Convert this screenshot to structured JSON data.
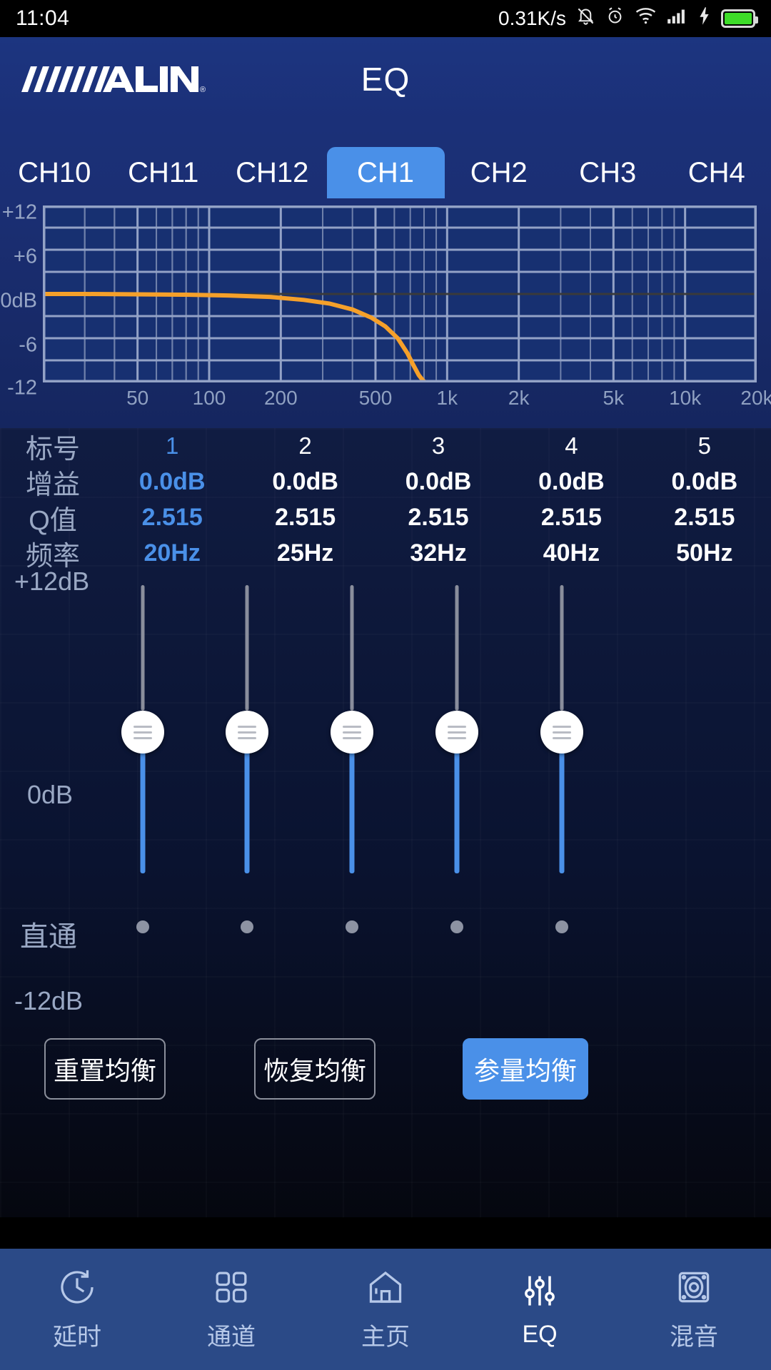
{
  "status_bar": {
    "time": "11:04",
    "network_speed": "0.31K/s",
    "icons": [
      "bell-mute-icon",
      "alarm-icon",
      "wifi-icon",
      "signal-icon",
      "charging-bolt-icon",
      "battery-icon"
    ],
    "battery_color": "#3ddc28"
  },
  "header": {
    "brand": "ALPINE",
    "brand_mark": "®",
    "title": "EQ"
  },
  "channel_tabs": {
    "items": [
      {
        "label": "CH10",
        "active": false
      },
      {
        "label": "CH11",
        "active": false
      },
      {
        "label": "CH12",
        "active": false
      },
      {
        "label": "CH1",
        "active": true
      },
      {
        "label": "CH2",
        "active": false
      },
      {
        "label": "CH3",
        "active": false
      },
      {
        "label": "CH4",
        "active": false
      }
    ],
    "active_color": "#4a90e8"
  },
  "chart_data": {
    "type": "line",
    "title": "",
    "xlabel": "",
    "ylabel": "",
    "x_ticks": [
      "50",
      "100",
      "200",
      "500",
      "1k",
      "2k",
      "5k",
      "10k",
      "20k"
    ],
    "x_tick_values": [
      50,
      100,
      200,
      500,
      1000,
      2000,
      5000,
      10000,
      20000
    ],
    "y_ticks": [
      "+12",
      "+6",
      "0dB",
      "-6",
      "-12"
    ],
    "y_tick_values": [
      12,
      6,
      0,
      -6,
      -12
    ],
    "xlim": [
      20,
      20000
    ],
    "ylim": [
      -12,
      12
    ],
    "grid": true,
    "log_x": true,
    "zero_line": true,
    "line_color": "#f5a02a",
    "grid_color": "#7f8fb5",
    "plot_bg": "#173071",
    "series": [
      {
        "name": "CH1 EQ response",
        "x": [
          20,
          30,
          50,
          80,
          120,
          180,
          250,
          320,
          400,
          480,
          550,
          620,
          680,
          720,
          760,
          790,
          810
        ],
        "values": [
          0.0,
          0.0,
          -0.05,
          -0.1,
          -0.2,
          -0.4,
          -0.8,
          -1.3,
          -2.1,
          -3.2,
          -4.4,
          -6.0,
          -8.0,
          -9.6,
          -11.0,
          -11.7,
          -12.0
        ]
      }
    ]
  },
  "band_table": {
    "row_labels": [
      "标号",
      "增益",
      "Q值",
      "频率"
    ],
    "columns": [
      {
        "index": "1",
        "gain": "0.0dB",
        "q": "2.515",
        "freq": "20Hz",
        "selected": true
      },
      {
        "index": "2",
        "gain": "0.0dB",
        "q": "2.515",
        "freq": "25Hz",
        "selected": false
      },
      {
        "index": "3",
        "gain": "0.0dB",
        "q": "2.515",
        "freq": "32Hz",
        "selected": false
      },
      {
        "index": "4",
        "gain": "0.0dB",
        "q": "2.515",
        "freq": "40Hz",
        "selected": false
      },
      {
        "index": "5",
        "gain": "0.0dB",
        "q": "2.515",
        "freq": "50Hz",
        "selected": false
      }
    ],
    "selected_color": "#4a90e8"
  },
  "sliders": {
    "top_label": "+12dB",
    "mid_label": "0dB",
    "bottom_label": "-12dB",
    "bypass_label": "直通",
    "track_active_color": "#4a90e8",
    "track_inactive_color": "#8a8e9c",
    "items": [
      {
        "band": "1",
        "value": "0dB"
      },
      {
        "band": "2",
        "value": "0dB"
      },
      {
        "band": "3",
        "value": "0dB"
      },
      {
        "band": "4",
        "value": "0dB"
      },
      {
        "band": "5",
        "value": "0dB"
      }
    ]
  },
  "actions": {
    "reset_label": "重置均衡",
    "restore_label": "恢复均衡",
    "parametric_label": "参量均衡"
  },
  "bottom_nav": {
    "items": [
      {
        "label": "延时",
        "icon": "clock-rotate-icon",
        "active": false
      },
      {
        "label": "通道",
        "icon": "grid-squares-icon",
        "active": false
      },
      {
        "label": "主页",
        "icon": "home-icon",
        "active": false
      },
      {
        "label": "EQ",
        "icon": "sliders-icon",
        "active": true
      },
      {
        "label": "混音",
        "icon": "speaker-icon",
        "active": false
      }
    ]
  }
}
